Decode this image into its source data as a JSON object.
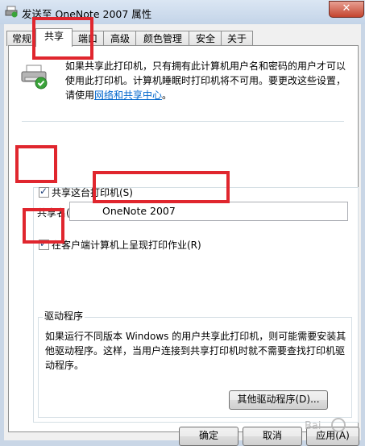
{
  "window": {
    "title": "发送至 OneNote 2007 属性",
    "close_label": "✕"
  },
  "tabs": [
    {
      "label": "常规",
      "active": false
    },
    {
      "label": "共享",
      "active": true
    },
    {
      "label": "端口",
      "active": false
    },
    {
      "label": "高级",
      "active": false
    },
    {
      "label": "颜色管理",
      "active": false
    },
    {
      "label": "安全",
      "active": false
    },
    {
      "label": "关于",
      "active": false
    }
  ],
  "share": {
    "info_text": "如果共享此打印机，只有拥有此计算机用户名和密码的用户才可以使用此打印机。计算机睡眠时打印机将不可用。要更改这些设置，请使用",
    "info_link": "网络和共享中心",
    "info_end": "。",
    "share_checkbox_label": "共享这台打印机(S)",
    "share_checked": true,
    "share_name_label": "共享名(H):",
    "share_name_value": "OneNote 2007",
    "render_checkbox_label": "在客户端计算机上呈现打印作业(R)",
    "render_checked": true
  },
  "drivers": {
    "legend": "驱动程序",
    "text": "如果运行不同版本 Windows 的用户共享此打印机，则可能需要安装其他驱动程序。这样，当用户连接到共享打印机时就不需要查找打印机驱动程序。",
    "button": "其他驱动程序(D)..."
  },
  "buttons": {
    "ok": "确定",
    "cancel": "取消",
    "apply": "应用(A)"
  },
  "colors": {
    "highlight": "#e0262e",
    "link": "#0066cc"
  }
}
